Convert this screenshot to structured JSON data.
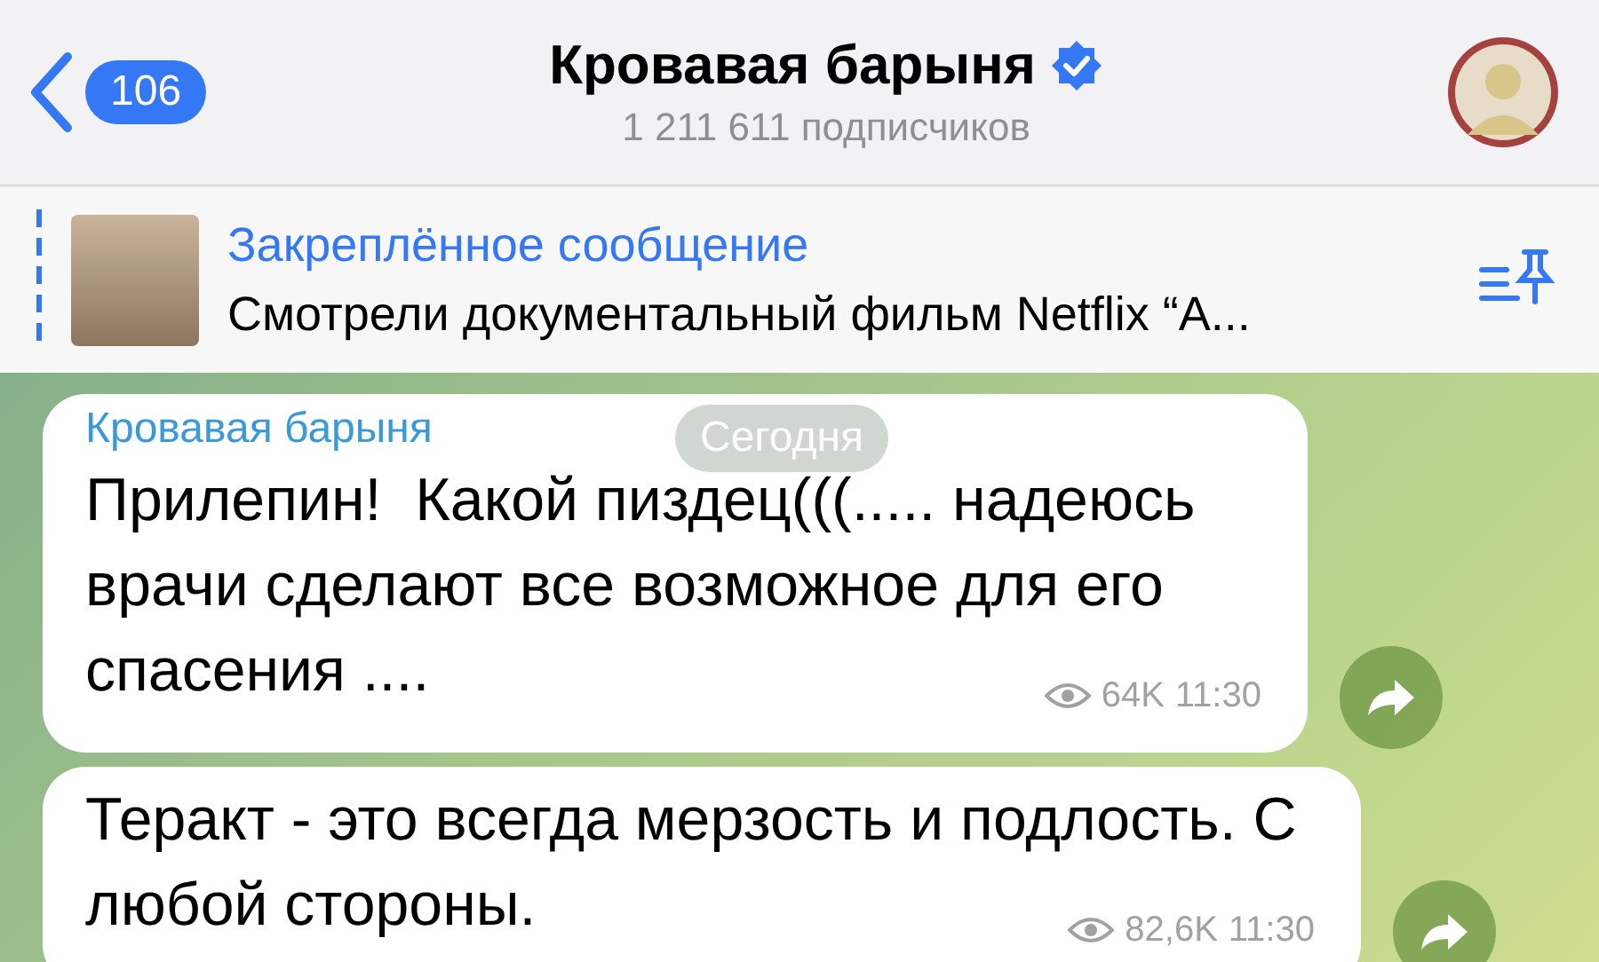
{
  "header": {
    "back_count": "106",
    "title": "Кровавая барыня",
    "verified": true,
    "subtitle": "1 211 611 подписчиков"
  },
  "pinned": {
    "label": "Закреплённое сообщение",
    "text": "Смотрели документальный фильм Netflix “A..."
  },
  "date_pill": "Сегодня",
  "messages": [
    {
      "author": "Кровавая барыня",
      "text": "Прилепин!  Какой пиздец(((..... надеюсь врачи сделают все возможное для его спасения ....",
      "views": "64K",
      "time": "11:30"
    },
    {
      "text": "Теракт - это всегда мерзость и подлость. С любой стороны.",
      "views": "82,6K",
      "time": "11:30"
    }
  ]
}
